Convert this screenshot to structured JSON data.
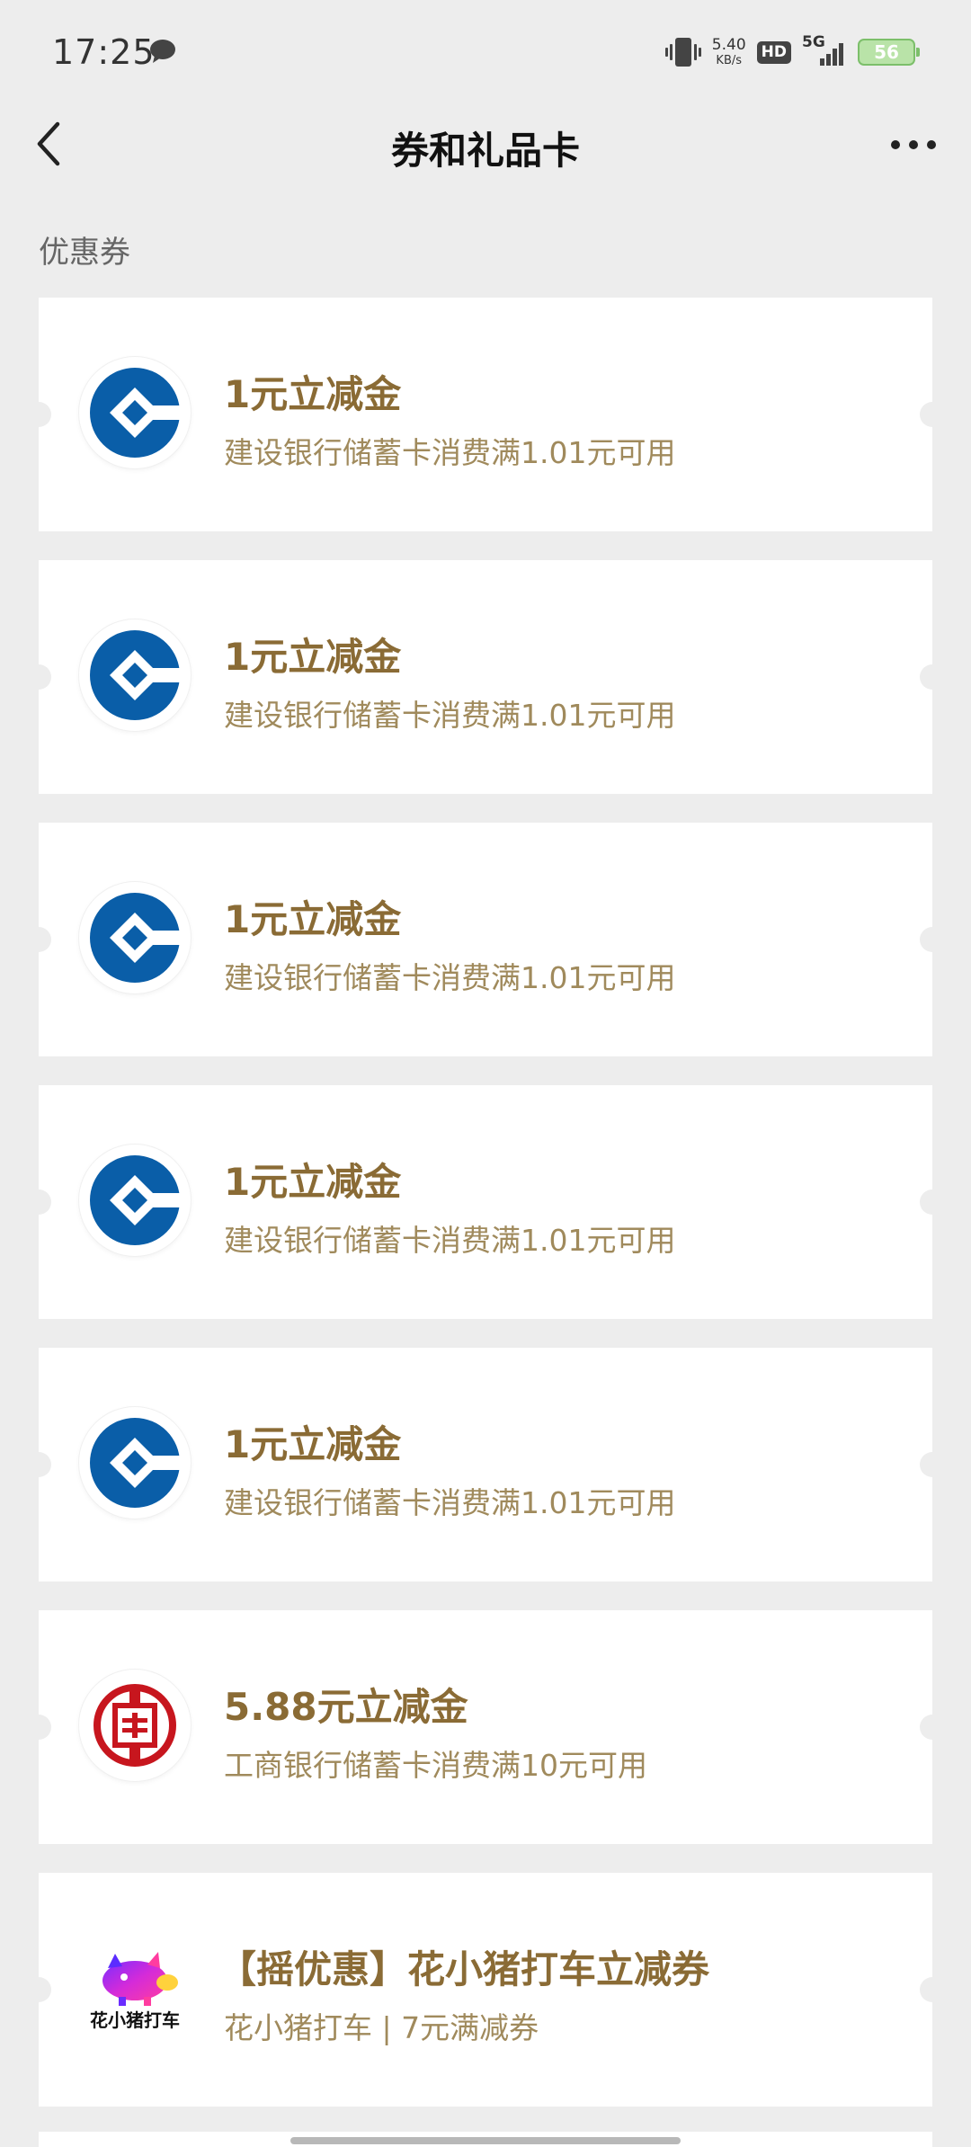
{
  "status_bar": {
    "time": "17:25",
    "net_speed_value": "5.40",
    "net_speed_unit": "KB/s",
    "hd_label": "HD",
    "network_label": "5G",
    "battery": "56"
  },
  "nav": {
    "title": "券和礼品卡"
  },
  "section": {
    "label": "优惠券"
  },
  "coupons": [
    {
      "title": "1元立减金",
      "desc": "建设银行储蓄卡消费满1.01元可用",
      "logo": "ccb-logo-icon"
    },
    {
      "title": "1元立减金",
      "desc": "建设银行储蓄卡消费满1.01元可用",
      "logo": "ccb-logo-icon"
    },
    {
      "title": "1元立减金",
      "desc": "建设银行储蓄卡消费满1.01元可用",
      "logo": "ccb-logo-icon"
    },
    {
      "title": "1元立减金",
      "desc": "建设银行储蓄卡消费满1.01元可用",
      "logo": "ccb-logo-icon"
    },
    {
      "title": "1元立减金",
      "desc": "建设银行储蓄卡消费满1.01元可用",
      "logo": "ccb-logo-icon"
    },
    {
      "title": "5.88元立减金",
      "desc": "工商银行储蓄卡消费满10元可用",
      "logo": "icbc-logo-icon"
    },
    {
      "title": "【摇优惠】花小猪打车立减券",
      "desc": "花小猪打车 | 7元满减券",
      "logo": "huaxiaozhu-logo-icon",
      "logo_text": "花小猪打车"
    }
  ],
  "colors": {
    "background": "#ededed",
    "coupon_title": "#8a6b35",
    "coupon_desc": "#a08a5c",
    "ccb_blue": "#0a5ea8",
    "icbc_red": "#c7161e"
  }
}
